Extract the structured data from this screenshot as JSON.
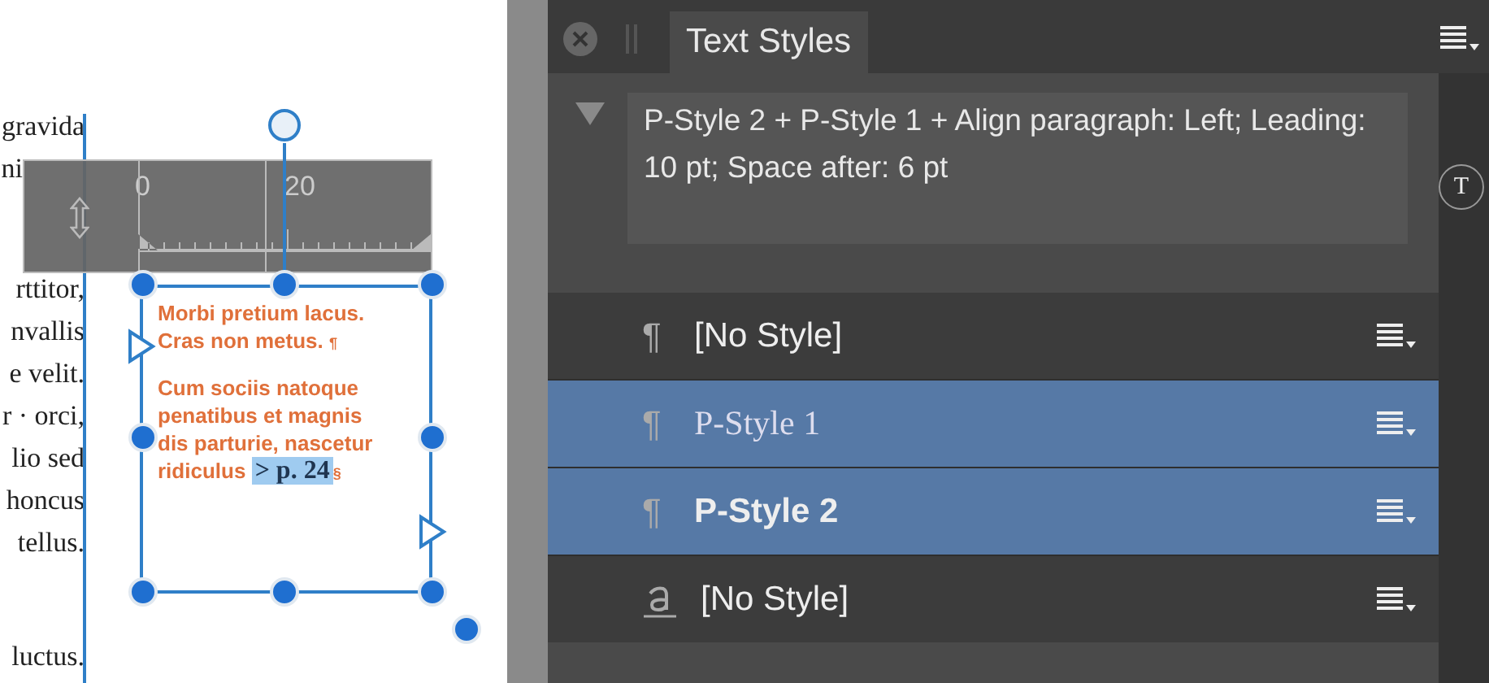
{
  "canvas": {
    "column_lines": [
      "gravida",
      "ni",
      "rttitor,",
      "nvallis",
      "e velit.",
      "r · orci,",
      "lio sed",
      "honcus",
      "tellus.",
      "luctus."
    ],
    "ruler": {
      "labels": [
        "0",
        "20"
      ]
    },
    "frame": {
      "paragraphs": [
        {
          "lines": [
            "Morbi pretium lacus.",
            "Cras non metus."
          ],
          "mark": "¶"
        },
        {
          "lines": [
            "Cum sociis natoque",
            "penatibus et magnis",
            "dis parturie, nascetur",
            "ridiculus"
          ],
          "link": "> p. 24",
          "mark": "§"
        }
      ]
    }
  },
  "panel": {
    "tab": {
      "label": "Text Styles",
      "selected": true
    },
    "style_button": "T",
    "description": "P-Style 2 + P-Style 1 + Align paragraph: Left; Leading: 10 pt; Space after: 6 pt",
    "styles": [
      {
        "kind": "paragraph",
        "icon": "¶",
        "serif": false,
        "bold": false,
        "name": "[No Style]",
        "selected": false
      },
      {
        "kind": "paragraph",
        "icon": "¶",
        "serif": true,
        "bold": false,
        "name": "P-Style 1",
        "selected": true
      },
      {
        "kind": "paragraph",
        "icon": "¶",
        "serif": false,
        "bold": true,
        "name": "P-Style 2",
        "selected": true
      },
      {
        "kind": "character",
        "serif": false,
        "bold": false,
        "name": "[No Style]",
        "selected": false
      }
    ]
  }
}
